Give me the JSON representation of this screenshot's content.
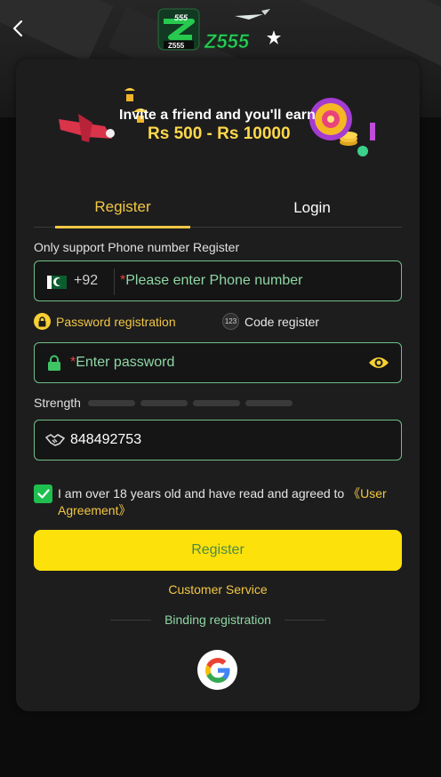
{
  "header": {
    "logo_text_top": "555",
    "logo_text_small": "Z555",
    "logo_text_main": "Z555"
  },
  "banner": {
    "line1": "Invite a friend and you'll earn",
    "line2": "Rs 500 - Rs 10000"
  },
  "tabs": [
    {
      "label": "Register",
      "active": true
    },
    {
      "label": "Login",
      "active": false
    }
  ],
  "form": {
    "phone_note": "Only support Phone number Register",
    "country_code": "+92",
    "phone_placeholder": "Please enter Phone number",
    "option_password": "Password registration",
    "option_code": "Code register",
    "option_code_badge": "123",
    "password_placeholder": "Enter password",
    "strength_label": "Strength",
    "strength_level": 0,
    "strength_segments": 4,
    "invite_code": "848492753",
    "agree_text": "I am over 18 years old and have read and agreed to ",
    "agree_link": "《User Agreement》",
    "agree_checked": true,
    "register_label": "Register",
    "customer_service": "Customer Service",
    "binding_label": "Binding registration"
  },
  "colors": {
    "accent": "#f2c744",
    "button": "#fde10a",
    "field_border": "#6fbf86",
    "placeholder": "#8fd7a4",
    "check": "#1fbf4f"
  },
  "icons": [
    "back-arrow-icon",
    "pakistan-flag-icon",
    "lock-icon",
    "eye-icon",
    "handshake-icon",
    "check-icon",
    "google-icon"
  ]
}
